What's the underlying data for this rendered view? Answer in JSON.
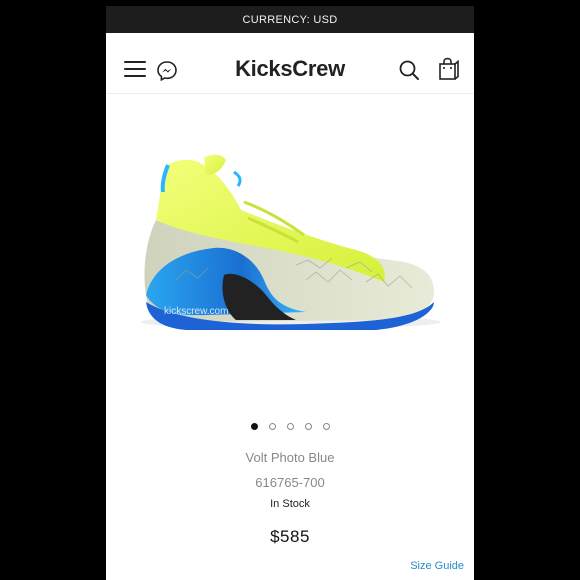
{
  "currency_bar": {
    "label": "CURRENCY: USD"
  },
  "header": {
    "logo": "KicksCrew",
    "icons": {
      "menu": "hamburger-menu-icon",
      "chat": "messenger-icon",
      "search": "search-icon",
      "bag": "shopping-bag-icon"
    }
  },
  "product": {
    "image_watermark": "kickscrew.com",
    "gallery": {
      "total_slides": 5,
      "active_slide": 1
    },
    "name": "Volt Photo Blue",
    "sku": "616765-700",
    "stock_status": "In Stock",
    "price": "$585"
  },
  "links": {
    "size_guide": "Size Guide"
  },
  "colors": {
    "accent_link": "#2a8cc8",
    "currency_bar_bg": "#1d1d1d",
    "shoe_volt": "#e6ff4d",
    "shoe_blue": "#1e7fd8"
  }
}
